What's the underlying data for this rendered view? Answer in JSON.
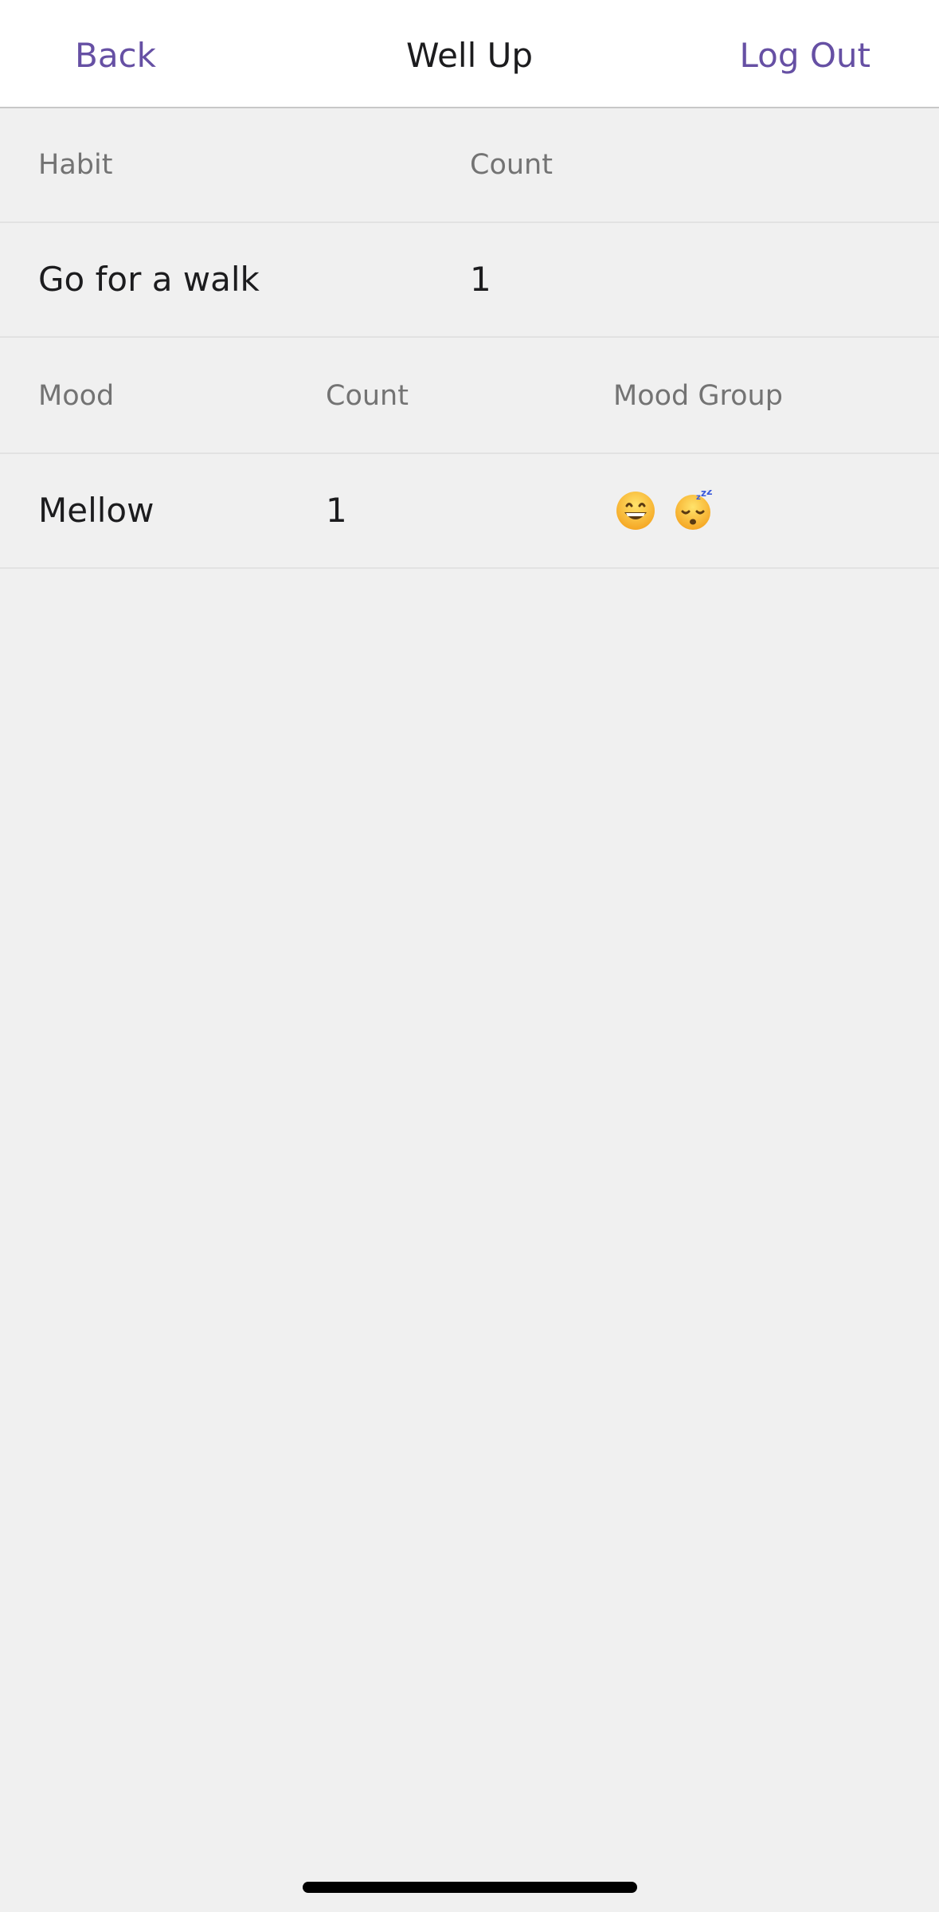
{
  "navbar": {
    "back_label": "Back",
    "title": "Well Up",
    "logout_label": "Log Out"
  },
  "habits_table": {
    "headers": [
      "Habit",
      "Count"
    ],
    "rows": [
      {
        "habit": "Go for a walk",
        "count": "1"
      }
    ]
  },
  "moods_table": {
    "headers": [
      "Mood",
      "Count",
      "Mood Group"
    ],
    "rows": [
      {
        "mood": "Mellow",
        "count": "1",
        "mood_group_icons": [
          "grinning-face-icon",
          "sleeping-face-icon"
        ]
      }
    ]
  },
  "colors": {
    "accent": "#6650a4",
    "background": "#f0f0f0",
    "navbar_bg": "#ffffff",
    "header_text": "#737373",
    "body_text": "#1c1c1e"
  }
}
